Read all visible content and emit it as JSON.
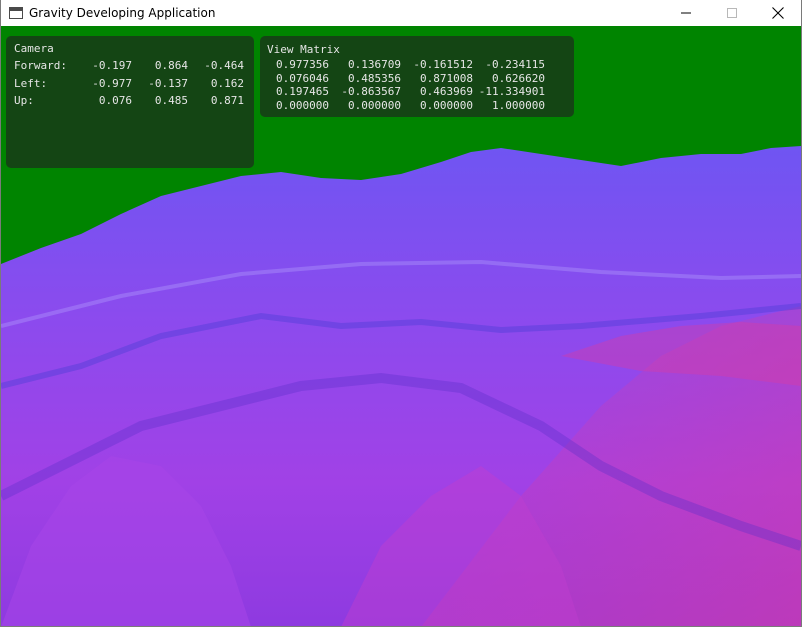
{
  "window": {
    "title": "Gravity Developing Application",
    "app_icon": "window-app-icon",
    "controls": [
      "minimize-icon",
      "maximize-icon",
      "close-icon"
    ]
  },
  "viewport": {
    "sky_color": "#008400",
    "terrain_colors": [
      "#7a4cf0",
      "#9b45ec",
      "#c03fd8",
      "#e23aa2"
    ]
  },
  "camera": {
    "title": "Camera",
    "rows": [
      {
        "label": "Forward:",
        "values": [
          "-0.197",
          "0.864",
          "-0.464"
        ]
      },
      {
        "label": "Left:",
        "values": [
          "-0.977",
          "-0.137",
          "0.162"
        ]
      },
      {
        "label": "Up:",
        "values": [
          "0.076",
          "0.485",
          "0.871"
        ]
      }
    ]
  },
  "view_matrix": {
    "title": "View Matrix",
    "rows": [
      [
        "0.977356",
        "0.136709",
        "-0.161512",
        "-0.234115"
      ],
      [
        "0.076046",
        "0.485356",
        "0.871008",
        "0.626620"
      ],
      [
        "0.197465",
        "-0.863567",
        "0.463969",
        "-11.334901"
      ],
      [
        "0.000000",
        "0.000000",
        "0.000000",
        "1.000000"
      ]
    ]
  }
}
